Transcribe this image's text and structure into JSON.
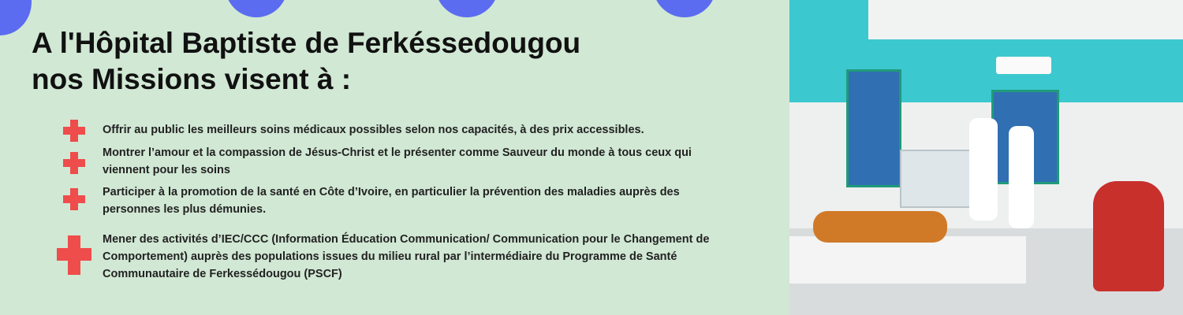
{
  "colors": {
    "background": "#d1e8d4",
    "circle": "#5b6cf0",
    "cross": "#ef4c4c",
    "title": "#111111",
    "text": "#222222"
  },
  "title": {
    "line1": "A l'Hôpital Baptiste de Ferkéssedougou",
    "line2": "nos Missions visent à :"
  },
  "missions": [
    {
      "icon": "red-cross-icon",
      "text": "Offrir au public les meilleurs soins médicaux possibles selon nos capacités, à des prix accessibles."
    },
    {
      "icon": "red-cross-icon",
      "text": "Montrer l’amour et la compassion de Jésus-Christ et le présenter comme Sauveur du monde à tous ceux qui viennent pour les soins"
    },
    {
      "icon": "red-cross-icon",
      "text": "Participer à la promotion de la santé en Côte d’Ivoire, en particulier la prévention des maladies auprès des personnes les plus démunies."
    },
    {
      "icon": "red-cross-icon",
      "text": "Mener des activités d’IEC/CCC (Information Éducation Communication/ Communication pour le Changement de Comportement) auprès des populations issues du milieu rural par l’intermédiaire du Programme de Santé Communautaire de Ferkessédougou (PSCF)"
    }
  ]
}
